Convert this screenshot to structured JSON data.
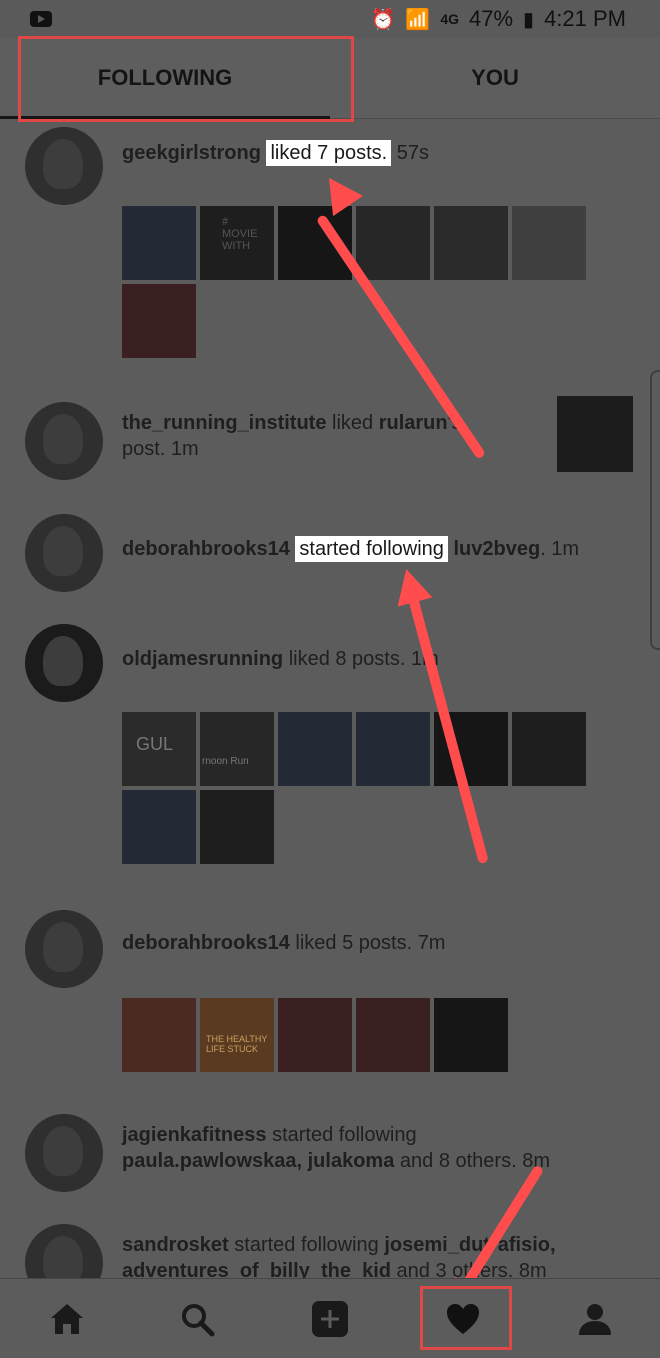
{
  "status_bar": {
    "time": "4:21 PM",
    "battery": "47%",
    "network": "4G"
  },
  "tabs": {
    "following": "FOLLOWING",
    "you": "YOU"
  },
  "feed": [
    {
      "user": "geekgirlstrong",
      "action": "liked 7 posts.",
      "time": "57s"
    },
    {
      "user": "the_running_institute",
      "action_pre": "liked",
      "target": "rularun",
      "action_post": "'s",
      "line2": "post. 1m"
    },
    {
      "user": "deborahbrooks14",
      "action": "started following",
      "target": "luv2bveg",
      "time": ". 1m"
    },
    {
      "user": "oldjamesrunning",
      "action": "liked 8 posts.",
      "time": "1m"
    },
    {
      "user": "deborahbrooks14",
      "action": "liked 5 posts.",
      "time": "7m"
    },
    {
      "user": "jagienkafitness",
      "action": "started following",
      "line2_targets": "paula.pawlowskaa, julakoma",
      "line2_rest": "and 8 others.",
      "time": "8m"
    },
    {
      "user": "sandrosket",
      "action": "started following",
      "target": "josemi_dutrafisio,",
      "line2_target": "adventures_of_billy_the_kid",
      "line2_rest": "and 3 others.",
      "time": "8m"
    }
  ],
  "thumb_text": {
    "movie": "#\nMOVIE\nWITH",
    "mug": "GUL",
    "run": "rnoon Run",
    "cafe": "THE HEALTHY LIFE STUCK"
  },
  "nav": [
    "home-icon",
    "search-icon",
    "add-icon",
    "heart-icon",
    "profile-icon"
  ],
  "colors": {
    "highlight_red": "#e04747",
    "arrow_red": "#ff4d4d"
  }
}
